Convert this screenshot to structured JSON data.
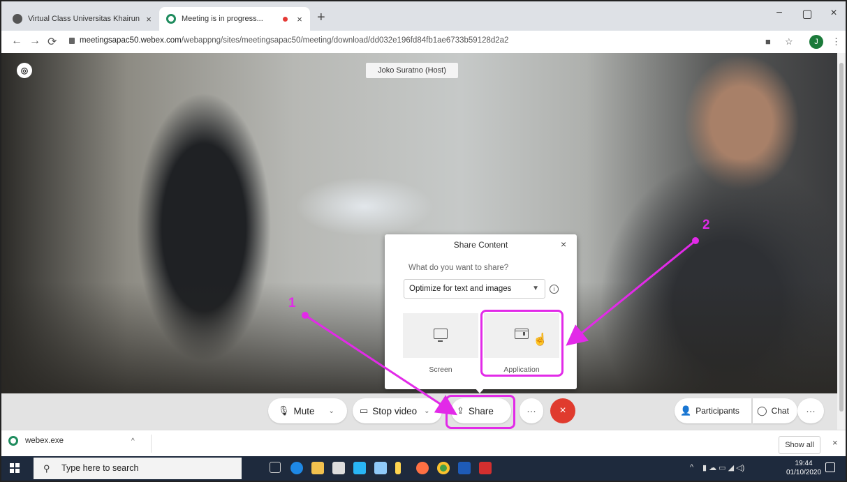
{
  "browser": {
    "tabs": [
      {
        "title": "Virtual Class Universitas Khairun",
        "close": "×"
      },
      {
        "title": "Meeting is in progress...",
        "close": "×"
      }
    ],
    "new_tab": "+",
    "window_controls": {
      "minimize": "−",
      "restore": "▢",
      "close": "×"
    },
    "url_host": "meetingsapac50.webex.com",
    "url_path": "/webappng/sites/meetingsapac50/meeting/download/dd032e196fd84fb1ae6733b59128d2a2",
    "profile_initial": "J"
  },
  "meeting": {
    "host_label": "Joko Suratno (Host)",
    "dialog": {
      "title": "Share Content",
      "question": "What do you want to share?",
      "optimize_value": "Optimize for text and images",
      "options": [
        {
          "label": "Screen"
        },
        {
          "label": "Application"
        }
      ]
    },
    "controls": {
      "mute": "Mute",
      "stop_video": "Stop video",
      "share": "Share",
      "more": "···",
      "end": "×",
      "participants": "Participants",
      "chat": "Chat",
      "more_right": "···"
    }
  },
  "downloads": {
    "file": "webex.exe",
    "show_all": "Show all",
    "close": "×"
  },
  "taskbar": {
    "search_placeholder": "Type here to search",
    "time": "19:44",
    "date": "01/10/2020"
  },
  "annotations": {
    "step1": "1",
    "step2": "2",
    "color": "#e22ae8"
  }
}
